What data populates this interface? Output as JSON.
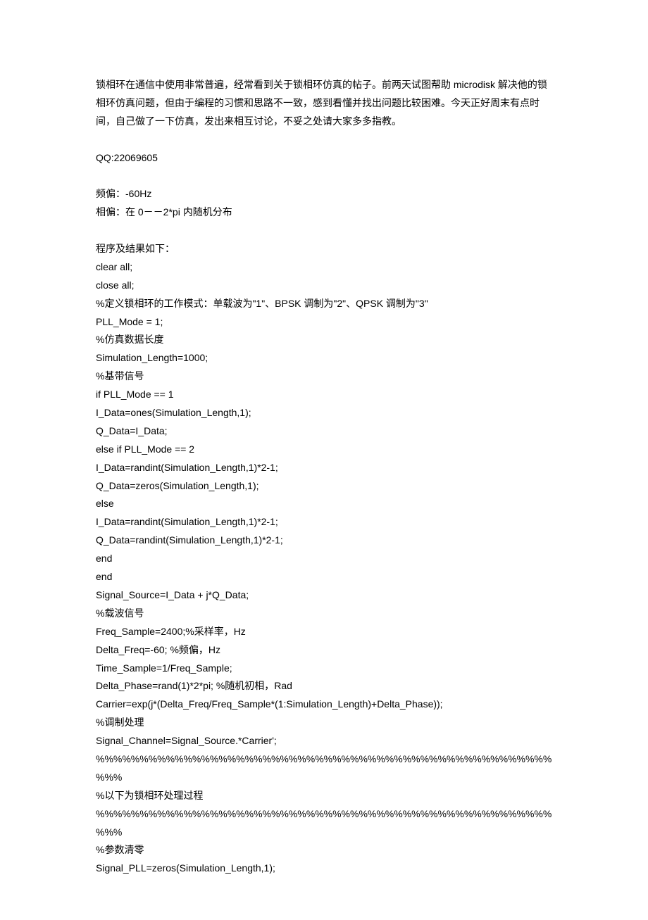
{
  "lines": [
    "锁相环在通信中使用非常普遍，经常看到关于锁相环仿真的帖子。前两天试图帮助 microdisk 解决他的锁相环仿真问题，但由于编程的习惯和思路不一致，感到看懂并找出问题比较困难。今天正好周末有点时间，自己做了一下仿真，发出来相互讨论，不妥之处请大家多多指教。",
    "",
    "QQ:22069605",
    "",
    "频偏：-60Hz",
    "相偏：在 0－－2*pi 内随机分布",
    "",
    "程序及结果如下：",
    "clear all;",
    "close all;",
    "%定义锁相环的工作模式：单载波为\"1\"、BPSK 调制为\"2\"、QPSK 调制为\"3\"",
    "PLL_Mode = 1;",
    "%仿真数据长度",
    "Simulation_Length=1000;",
    "%基带信号",
    "if PLL_Mode == 1",
    "I_Data=ones(Simulation_Length,1);",
    "Q_Data=I_Data;",
    "else if PLL_Mode == 2",
    "I_Data=randint(Simulation_Length,1)*2-1;",
    "Q_Data=zeros(Simulation_Length,1);",
    "else",
    "I_Data=randint(Simulation_Length,1)*2-1;",
    "Q_Data=randint(Simulation_Length,1)*2-1;",
    "end",
    "end",
    "Signal_Source=I_Data + j*Q_Data;",
    "%载波信号",
    "Freq_Sample=2400;%采样率，Hz",
    "Delta_Freq=-60; %频偏，Hz",
    "Time_Sample=1/Freq_Sample;",
    "Delta_Phase=rand(1)*2*pi; %随机初相，Rad",
    "Carrier=exp(j*(Delta_Freq/Freq_Sample*(1:Simulation_Length)+Delta_Phase));",
    "%调制处理",
    "Signal_Channel=Signal_Source.*Carrier';",
    "%%%%%%%%%%%%%%%%%%%%%%%%%%%%%%%%%%%%%%%%%%%%%%%%%%%%%%%",
    "%以下为锁相环处理过程",
    "%%%%%%%%%%%%%%%%%%%%%%%%%%%%%%%%%%%%%%%%%%%%%%%%%%%%%%%",
    "%参数清零",
    "Signal_PLL=zeros(Simulation_Length,1);"
  ]
}
